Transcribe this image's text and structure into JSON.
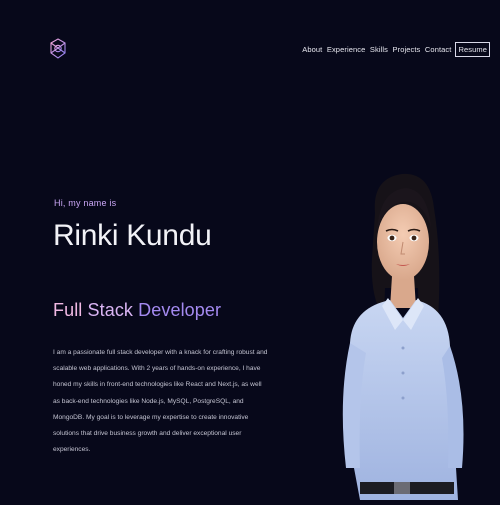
{
  "header": {
    "logo_icon": "geometric-knot-logo-icon",
    "nav": {
      "about": "About",
      "experience": "Experience",
      "skills": "Skills",
      "projects": "Projects",
      "contact": "Contact",
      "resume": "Resume"
    }
  },
  "hero": {
    "greeting": "Hi, my name is",
    "name": "Rinki Kundu",
    "role_words": [
      "Full",
      "Stack",
      "Developer"
    ],
    "bio": "I am a passionate full stack developer with a knack for crafting robust and scalable web applications. With 2 years of hands-on experience, I have honed my skills in front-end technologies like React and Next.js, as well as back-end technologies like Node.js, MySQL, PostgreSQL, and MongoDB. My goal is to leverage my expertise to create innovative solutions that drive business growth and deliver exceptional user experiences.",
    "avatar_icon": "3d-avatar-woman-illustration"
  },
  "colors": {
    "background": "#07081a",
    "greeting": "#c9a6f5",
    "role_gradient": [
      "#f0b9e4",
      "#d9b4f3",
      "#a48af0"
    ]
  }
}
